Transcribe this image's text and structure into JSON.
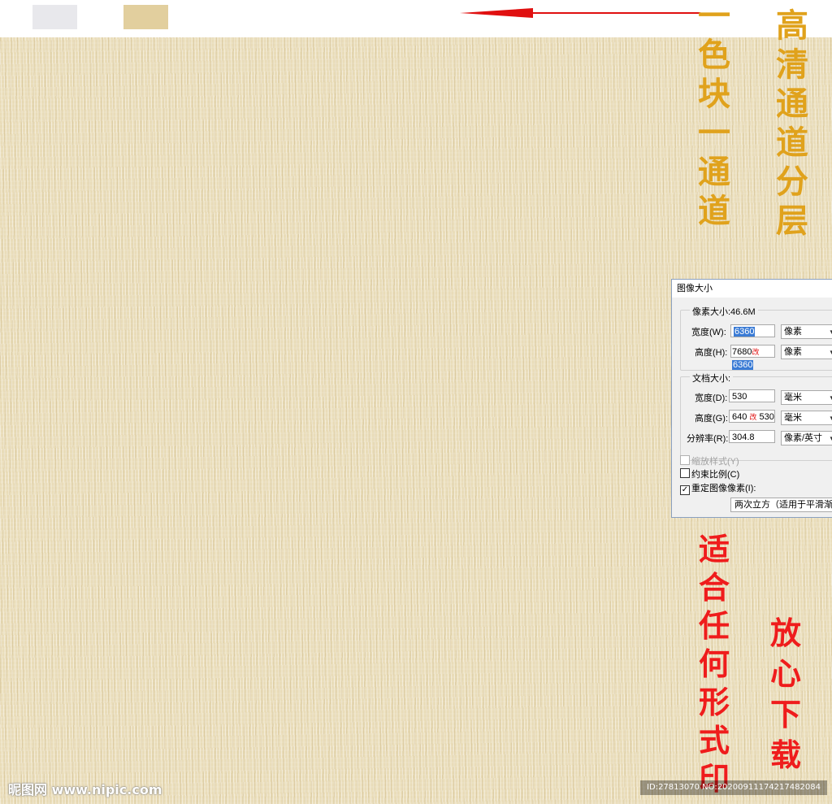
{
  "swatches": {
    "gray_color": "#e8e8ec",
    "beige_color": "#e2cf9e"
  },
  "arrow_color": "#e01010",
  "canvas": {
    "base_color": "#e9dcb8"
  },
  "vertical_texts": {
    "gold_left": [
      "一",
      "色",
      "块",
      "一",
      "通",
      "道"
    ],
    "gold_right": [
      "高",
      "清",
      "通",
      "道",
      "分",
      "层"
    ],
    "red_left": [
      "适",
      "合",
      "任",
      "何",
      "形",
      "式",
      "印"
    ],
    "red_right": [
      "放",
      "心",
      "下",
      "载"
    ]
  },
  "dialog": {
    "title": "图像大小",
    "pixel_group_label": "像素大小:46.6M",
    "pixel_width_label": "宽度(W):",
    "pixel_width_value": "6360",
    "pixel_width_unit": "像素",
    "pixel_height_label": "高度(H):",
    "pixel_height_old": "7680",
    "pixel_height_mark": "改",
    "pixel_height_value": "6360",
    "pixel_height_unit": "像素",
    "doc_group_label": "文档大小:",
    "doc_width_label": "宽度(D):",
    "doc_width_value": "530",
    "doc_width_unit": "毫米",
    "doc_height_label": "高度(G):",
    "doc_height_old": "640",
    "doc_height_mark": "改",
    "doc_height_value": "530",
    "doc_height_unit": "毫米",
    "resolution_label": "分辨率(R):",
    "resolution_value": "304.8",
    "resolution_unit": "像素/英寸",
    "scale_styles_label": "缩放样式(Y)",
    "constrain_label": "约束比例(C)",
    "resample_label": "重定图像像素(I):",
    "resample_method": "两次立方（适用于平滑渐变"
  },
  "watermarks": {
    "left": "昵图网 www.nipic.com",
    "right": "ID:27813070 NO:20200911174217482084"
  }
}
